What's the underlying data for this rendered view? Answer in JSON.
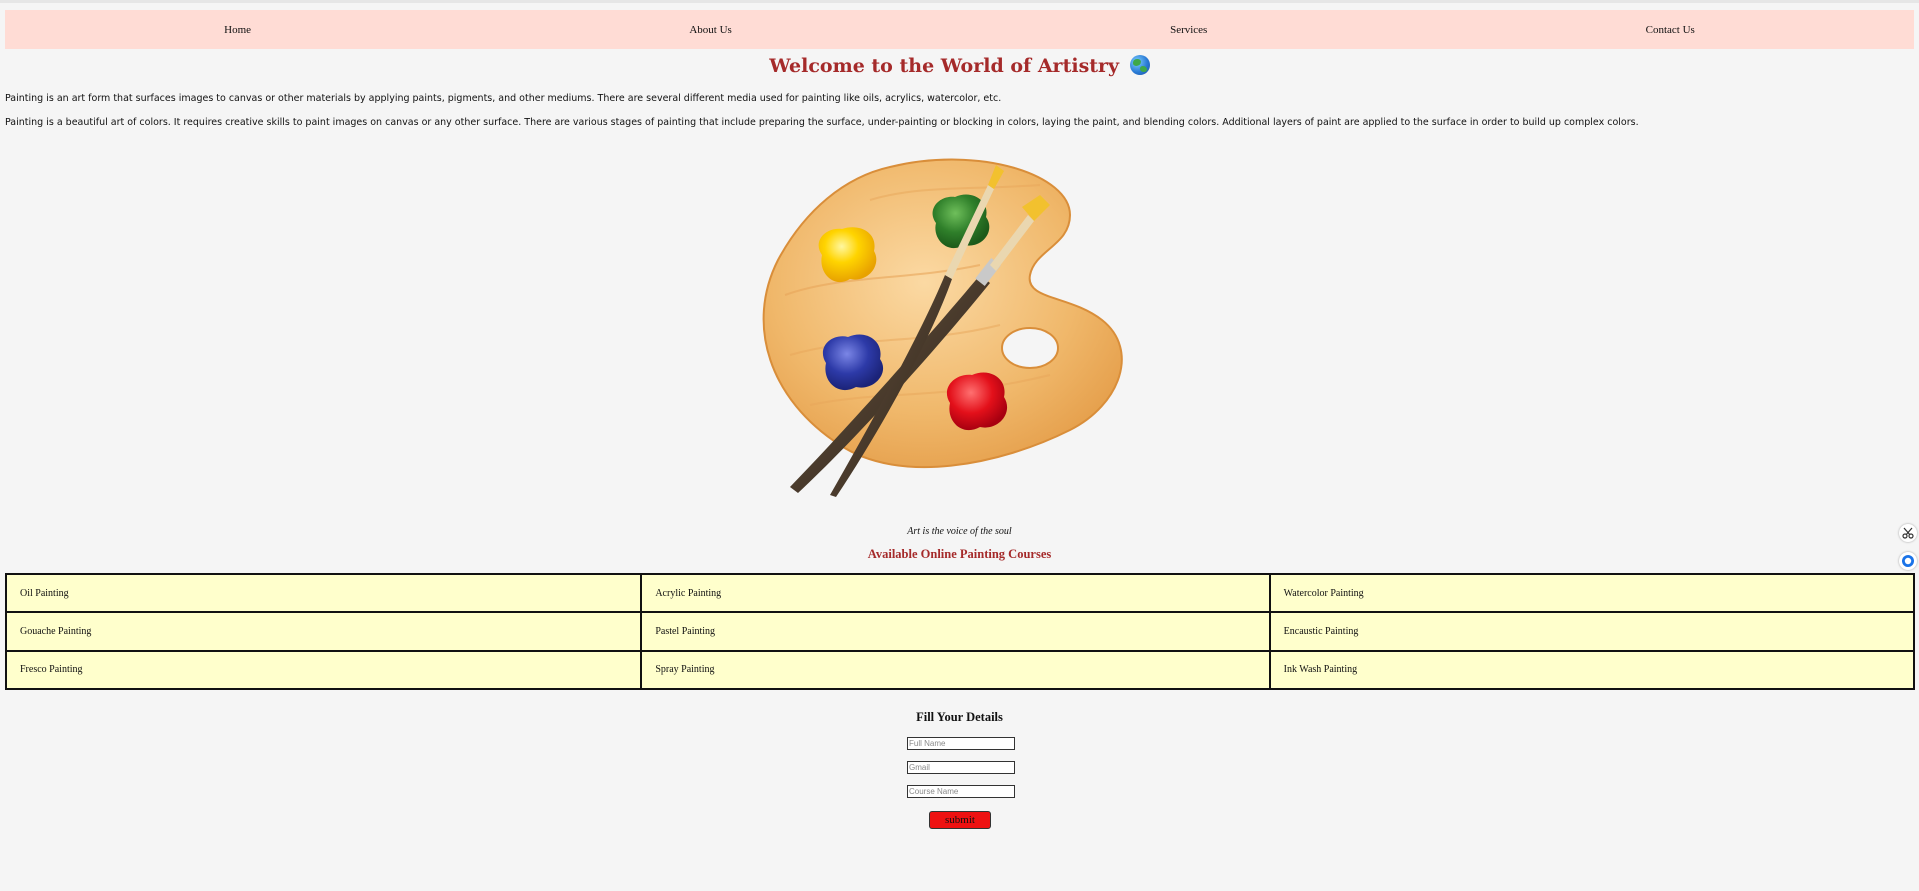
{
  "nav": {
    "items": [
      "Home",
      "About Us",
      "Services",
      "Contact Us"
    ]
  },
  "header": {
    "title": "Welcome to the World of Artistry",
    "icon": "globe-icon"
  },
  "content": {
    "paragraph1": "Painting is an art form that surfaces images to canvas or other materials by applying paints, pigments, and other mediums. There are several different media used for painting like oils, acrylics, watercolor, etc.",
    "paragraph2": "Painting is a beautiful art of colors. It requires creative skills to paint images on canvas or any other surface. There are various stages of painting that include preparing the surface, under-painting or blocking in colors, laying the paint, and blending colors. Additional layers of paint are applied to the surface in order to build up complex colors.",
    "image": "paint-palette-with-brushes",
    "caption": "Art is the voice of the soul"
  },
  "courses": {
    "heading": "Available Online Painting Courses",
    "rows": [
      [
        "Oil Painting",
        "Acrylic Painting",
        "Watercolor Painting"
      ],
      [
        "Gouache Painting",
        "Pastel Painting",
        "Encaustic Painting"
      ],
      [
        "Fresco Painting",
        "Spray Painting",
        "Ink Wash Painting"
      ]
    ]
  },
  "form": {
    "title": "Fill Your Details",
    "name_placeholder": "Full Name",
    "email_placeholder": "Gmail",
    "course_placeholder": "Course Name",
    "submit_label": "submit"
  },
  "side_tools": {
    "icons": [
      "scissors-icon",
      "chat-icon"
    ]
  },
  "colors": {
    "nav_bg": "#ffdcd5",
    "heading": "#a52a2a",
    "table_bg": "#ffffcc",
    "submit_bg": "#ee1111"
  }
}
